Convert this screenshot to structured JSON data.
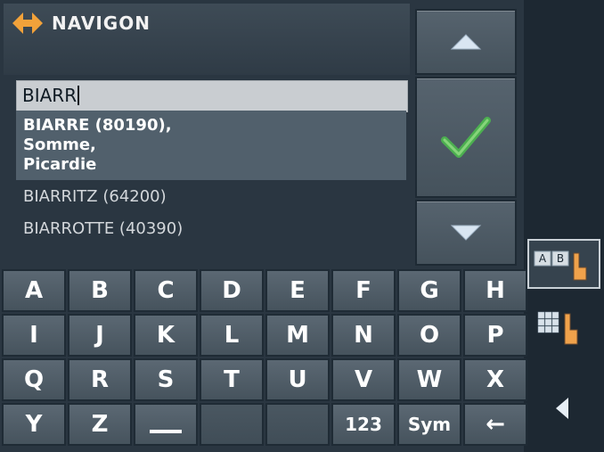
{
  "app": {
    "brand": "NAVIGON"
  },
  "search": {
    "value": "BIARR"
  },
  "results": [
    {
      "lines": [
        "BIARRE (80190),",
        "Somme,",
        "Picardie"
      ],
      "selected": true
    },
    {
      "lines": [
        "BIARRITZ (64200)"
      ],
      "selected": false
    },
    {
      "lines": [
        "BIARROTTE (40390)"
      ],
      "selected": false
    }
  ],
  "keyboard": {
    "rows": [
      [
        "A",
        "B",
        "C",
        "D",
        "E",
        "F",
        "G",
        "H"
      ],
      [
        "I",
        "J",
        "K",
        "L",
        "M",
        "N",
        "O",
        "P"
      ],
      [
        "Q",
        "R",
        "S",
        "T",
        "U",
        "V",
        "W",
        "X"
      ],
      [
        "Y",
        "Z",
        "",
        "",
        "",
        "123",
        "Sym",
        "←"
      ]
    ]
  },
  "icons": {
    "logo": "navigon-logo-icon",
    "up": "arrow-up-icon",
    "ok": "checkmark-icon",
    "down": "arrow-down-icon",
    "abc": "abc-keyboard-toggle-icon",
    "grid": "grid-keyboard-toggle-icon",
    "back": "back-arrow-icon"
  },
  "abc_icon_text": [
    "A",
    "B"
  ],
  "colors": {
    "logo_orange": "#f2a23a",
    "check_green": "#4caf50",
    "hand_orange": "#f0a24b"
  }
}
